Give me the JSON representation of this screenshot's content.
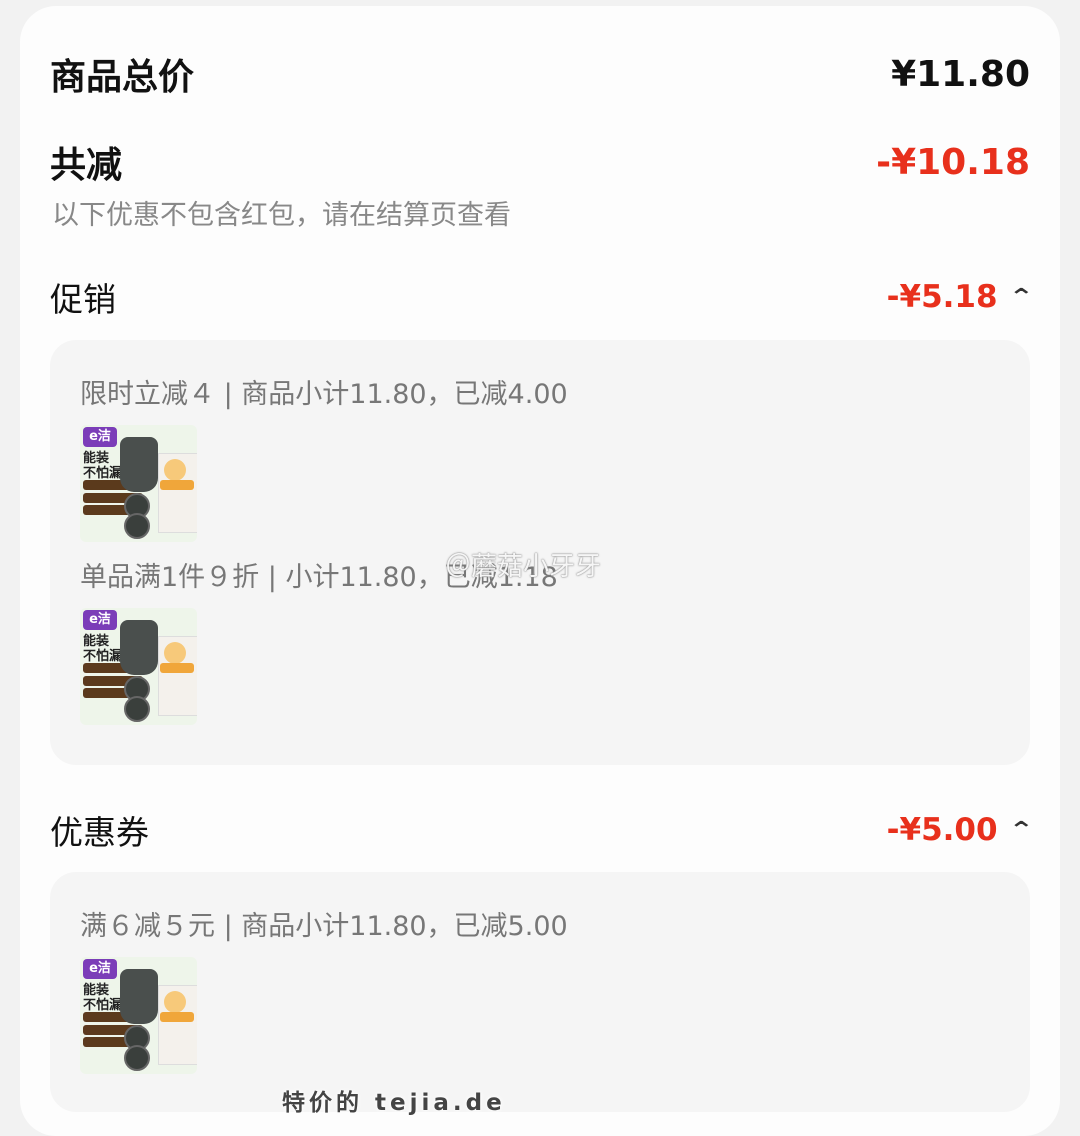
{
  "summary": {
    "total_label": "商品总价",
    "total_value": "¥11.80",
    "discount_label": "共减",
    "discount_value": "-¥10.18",
    "note": "以下优惠不包含红包，请在结算页查看"
  },
  "promotion": {
    "title": "促销",
    "amount": "-¥5.18",
    "chevron": "⌃",
    "items": [
      {
        "text": "限时立减４ | 商品小计11.80，已减4.00"
      },
      {
        "text": "单品满1件９折 | 小计11.80，已减1.18"
      }
    ]
  },
  "coupon": {
    "title": "优惠券",
    "amount": "-¥5.00",
    "chevron": "⌃",
    "items": [
      {
        "text": "满６减５元 | 商品小计11.80，已减5.00"
      }
    ]
  },
  "product_thumb": {
    "logo": "e洁",
    "line1": "能装",
    "line2": "不怕漏"
  },
  "overlay": {
    "watermark": "＠蘑菇小牙牙",
    "footer": "特价的 tejia.de"
  },
  "colors": {
    "accent_red": "#e8301c"
  },
  "icons": [
    "chevron-up-icon",
    "product-thumbnail",
    "weibo-icon"
  ]
}
